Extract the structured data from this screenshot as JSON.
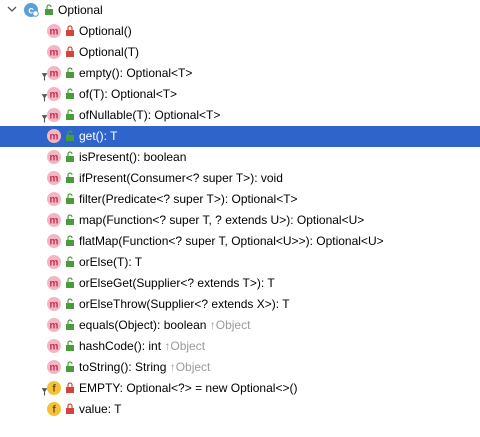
{
  "root": {
    "label": "Optional",
    "icon": "class-icon",
    "expanded": true
  },
  "members": [
    {
      "label": "Optional()",
      "kind": "method",
      "visibility": "private",
      "static": false,
      "inherited": ""
    },
    {
      "label": "Optional(T)",
      "kind": "method",
      "visibility": "private",
      "static": false,
      "inherited": ""
    },
    {
      "label": "empty(): Optional<T>",
      "kind": "method",
      "visibility": "public",
      "static": true,
      "inherited": ""
    },
    {
      "label": "of(T): Optional<T>",
      "kind": "method",
      "visibility": "public",
      "static": true,
      "inherited": ""
    },
    {
      "label": "ofNullable(T): Optional<T>",
      "kind": "method",
      "visibility": "public",
      "static": true,
      "inherited": ""
    },
    {
      "label": "get(): T",
      "kind": "method",
      "visibility": "public",
      "static": false,
      "inherited": "",
      "selected": true
    },
    {
      "label": "isPresent(): boolean",
      "kind": "method",
      "visibility": "public",
      "static": false,
      "inherited": ""
    },
    {
      "label": "ifPresent(Consumer<? super T>): void",
      "kind": "method",
      "visibility": "public",
      "static": false,
      "inherited": ""
    },
    {
      "label": "filter(Predicate<? super T>): Optional<T>",
      "kind": "method",
      "visibility": "public",
      "static": false,
      "inherited": ""
    },
    {
      "label": "map(Function<? super T, ? extends U>): Optional<U>",
      "kind": "method",
      "visibility": "public",
      "static": false,
      "inherited": ""
    },
    {
      "label": "flatMap(Function<? super T, Optional<U>>): Optional<U>",
      "kind": "method",
      "visibility": "public",
      "static": false,
      "inherited": ""
    },
    {
      "label": "orElse(T): T",
      "kind": "method",
      "visibility": "public",
      "static": false,
      "inherited": ""
    },
    {
      "label": "orElseGet(Supplier<? extends T>): T",
      "kind": "method",
      "visibility": "public",
      "static": false,
      "inherited": ""
    },
    {
      "label": "orElseThrow(Supplier<? extends X>): T",
      "kind": "method",
      "visibility": "public",
      "static": false,
      "inherited": ""
    },
    {
      "label": "equals(Object): boolean",
      "kind": "method",
      "visibility": "public",
      "static": false,
      "inherited": "↑Object"
    },
    {
      "label": "hashCode(): int",
      "kind": "method",
      "visibility": "public",
      "static": false,
      "inherited": "↑Object"
    },
    {
      "label": "toString(): String",
      "kind": "method",
      "visibility": "public",
      "static": false,
      "inherited": "↑Object"
    },
    {
      "label": "EMPTY: Optional<?> = new Optional<>()",
      "kind": "field",
      "visibility": "private",
      "static": true,
      "inherited": ""
    },
    {
      "label": "value: T",
      "kind": "field",
      "visibility": "private",
      "static": false,
      "inherited": ""
    }
  ],
  "colors": {
    "selection": "#2f65ca",
    "method_icon": "#f3b6c4",
    "method_letter": "#c62d4c",
    "field_icon": "#f3c13a",
    "field_letter": "#7a4b00",
    "class_icon": "#5aa0d8",
    "public_lock": "#4a9b3c",
    "private_lock": "#d2453b",
    "inherited_text": "#9a9a9a"
  },
  "icons": {
    "method": "method-icon",
    "field": "field-icon",
    "static_marker": "static-pin-icon",
    "public": "public-lock-icon",
    "private": "private-lock-icon",
    "expand": "chevron-down-icon"
  }
}
